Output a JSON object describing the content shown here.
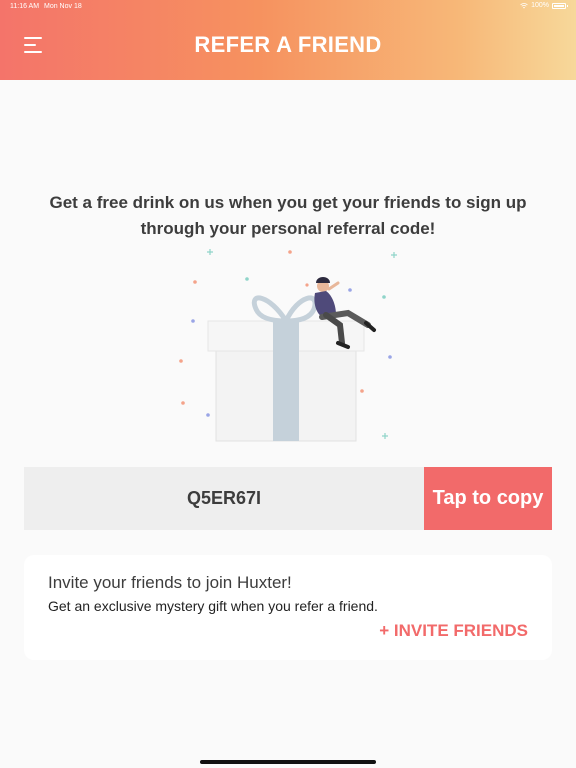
{
  "status_bar": {
    "time": "11:16 AM",
    "date": "Mon Nov 18",
    "battery": "100%"
  },
  "header": {
    "title": "REFER A FRIEND",
    "menu_icon": "hamburger-menu-icon"
  },
  "main": {
    "headline": "Get a free drink on us when you get your friends to sign up through your personal referral code!",
    "illustration": "gift-box-with-person-illustration",
    "referral_code": "Q5ER67I",
    "copy_label": "Tap to copy"
  },
  "invite_card": {
    "title": "Invite your friends to join Huxter!",
    "subtitle": "Get an exclusive mystery gift when you refer a friend.",
    "action_label": "+ INVITE FRIENDS"
  },
  "colors": {
    "gradient_start": "#f4746a",
    "gradient_end": "#f7d89a",
    "accent": "#f26a6a",
    "code_background": "#eeeeee",
    "text": "#3d3d3d"
  }
}
